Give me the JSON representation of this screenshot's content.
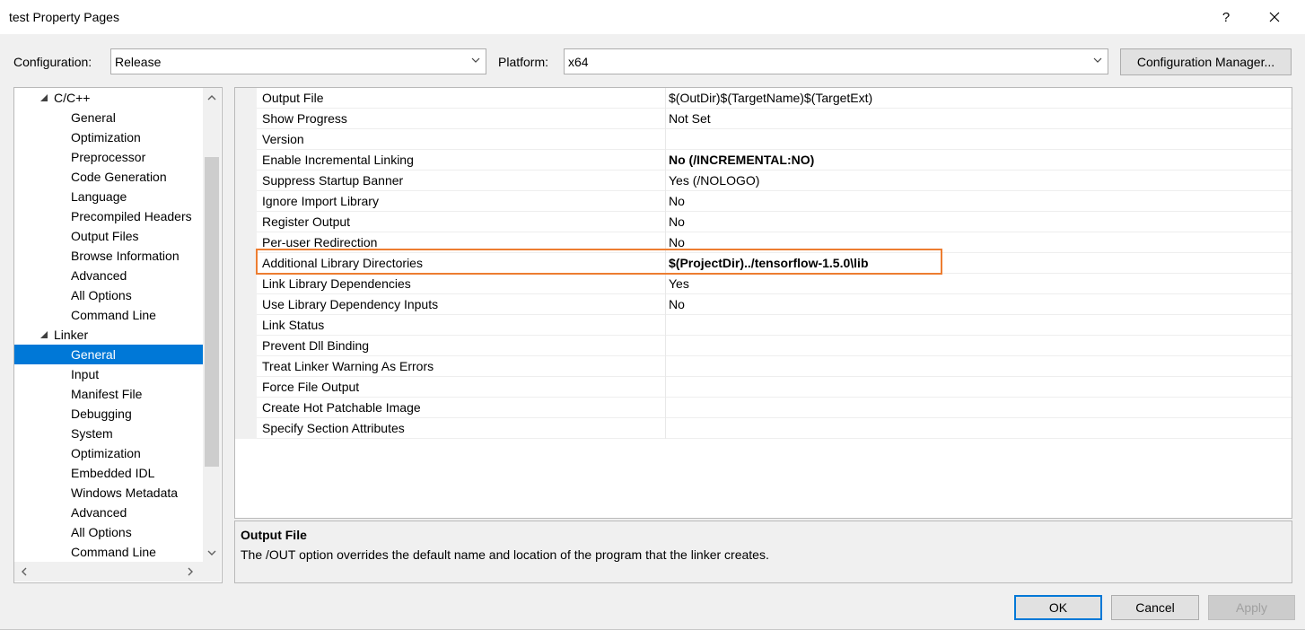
{
  "window": {
    "title": "test Property Pages",
    "help_label": "?"
  },
  "config_bar": {
    "configuration_label": "Configuration:",
    "configuration_value": "Release",
    "platform_label": "Platform:",
    "platform_value": "x64",
    "config_manager_label": "Configuration Manager..."
  },
  "tree": {
    "items": [
      {
        "label": "C/C++",
        "level": 0,
        "expanded": true
      },
      {
        "label": "General",
        "level": 1
      },
      {
        "label": "Optimization",
        "level": 1
      },
      {
        "label": "Preprocessor",
        "level": 1
      },
      {
        "label": "Code Generation",
        "level": 1
      },
      {
        "label": "Language",
        "level": 1
      },
      {
        "label": "Precompiled Headers",
        "level": 1
      },
      {
        "label": "Output Files",
        "level": 1
      },
      {
        "label": "Browse Information",
        "level": 1
      },
      {
        "label": "Advanced",
        "level": 1
      },
      {
        "label": "All Options",
        "level": 1
      },
      {
        "label": "Command Line",
        "level": 1
      },
      {
        "label": "Linker",
        "level": 0,
        "expanded": true
      },
      {
        "label": "General",
        "level": 1,
        "selected": true
      },
      {
        "label": "Input",
        "level": 1
      },
      {
        "label": "Manifest File",
        "level": 1
      },
      {
        "label": "Debugging",
        "level": 1
      },
      {
        "label": "System",
        "level": 1
      },
      {
        "label": "Optimization",
        "level": 1
      },
      {
        "label": "Embedded IDL",
        "level": 1
      },
      {
        "label": "Windows Metadata",
        "level": 1
      },
      {
        "label": "Advanced",
        "level": 1
      },
      {
        "label": "All Options",
        "level": 1
      },
      {
        "label": "Command Line",
        "level": 1
      }
    ]
  },
  "properties": [
    {
      "name": "Output File",
      "value": "$(OutDir)$(TargetName)$(TargetExt)",
      "bold": false
    },
    {
      "name": "Show Progress",
      "value": "Not Set",
      "bold": false
    },
    {
      "name": "Version",
      "value": "",
      "bold": false
    },
    {
      "name": "Enable Incremental Linking",
      "value": "No (/INCREMENTAL:NO)",
      "bold": true
    },
    {
      "name": "Suppress Startup Banner",
      "value": "Yes (/NOLOGO)",
      "bold": false
    },
    {
      "name": "Ignore Import Library",
      "value": "No",
      "bold": false
    },
    {
      "name": "Register Output",
      "value": "No",
      "bold": false
    },
    {
      "name": "Per-user Redirection",
      "value": "No",
      "bold": false
    },
    {
      "name": "Additional Library Directories",
      "value": "$(ProjectDir)../tensorflow-1.5.0\\lib",
      "bold": true,
      "highlighted": true
    },
    {
      "name": "Link Library Dependencies",
      "value": "Yes",
      "bold": false
    },
    {
      "name": "Use Library Dependency Inputs",
      "value": "No",
      "bold": false
    },
    {
      "name": "Link Status",
      "value": "",
      "bold": false
    },
    {
      "name": "Prevent Dll Binding",
      "value": "",
      "bold": false
    },
    {
      "name": "Treat Linker Warning As Errors",
      "value": "",
      "bold": false
    },
    {
      "name": "Force File Output",
      "value": "",
      "bold": false
    },
    {
      "name": "Create Hot Patchable Image",
      "value": "",
      "bold": false
    },
    {
      "name": "Specify Section Attributes",
      "value": "",
      "bold": false
    }
  ],
  "description": {
    "title": "Output File",
    "text": "The /OUT option overrides the default name and location of the program that the linker creates."
  },
  "buttons": {
    "ok": "OK",
    "cancel": "Cancel",
    "apply": "Apply"
  },
  "colors": {
    "selection": "#0078d7",
    "highlight_box": "#ed7d31"
  }
}
